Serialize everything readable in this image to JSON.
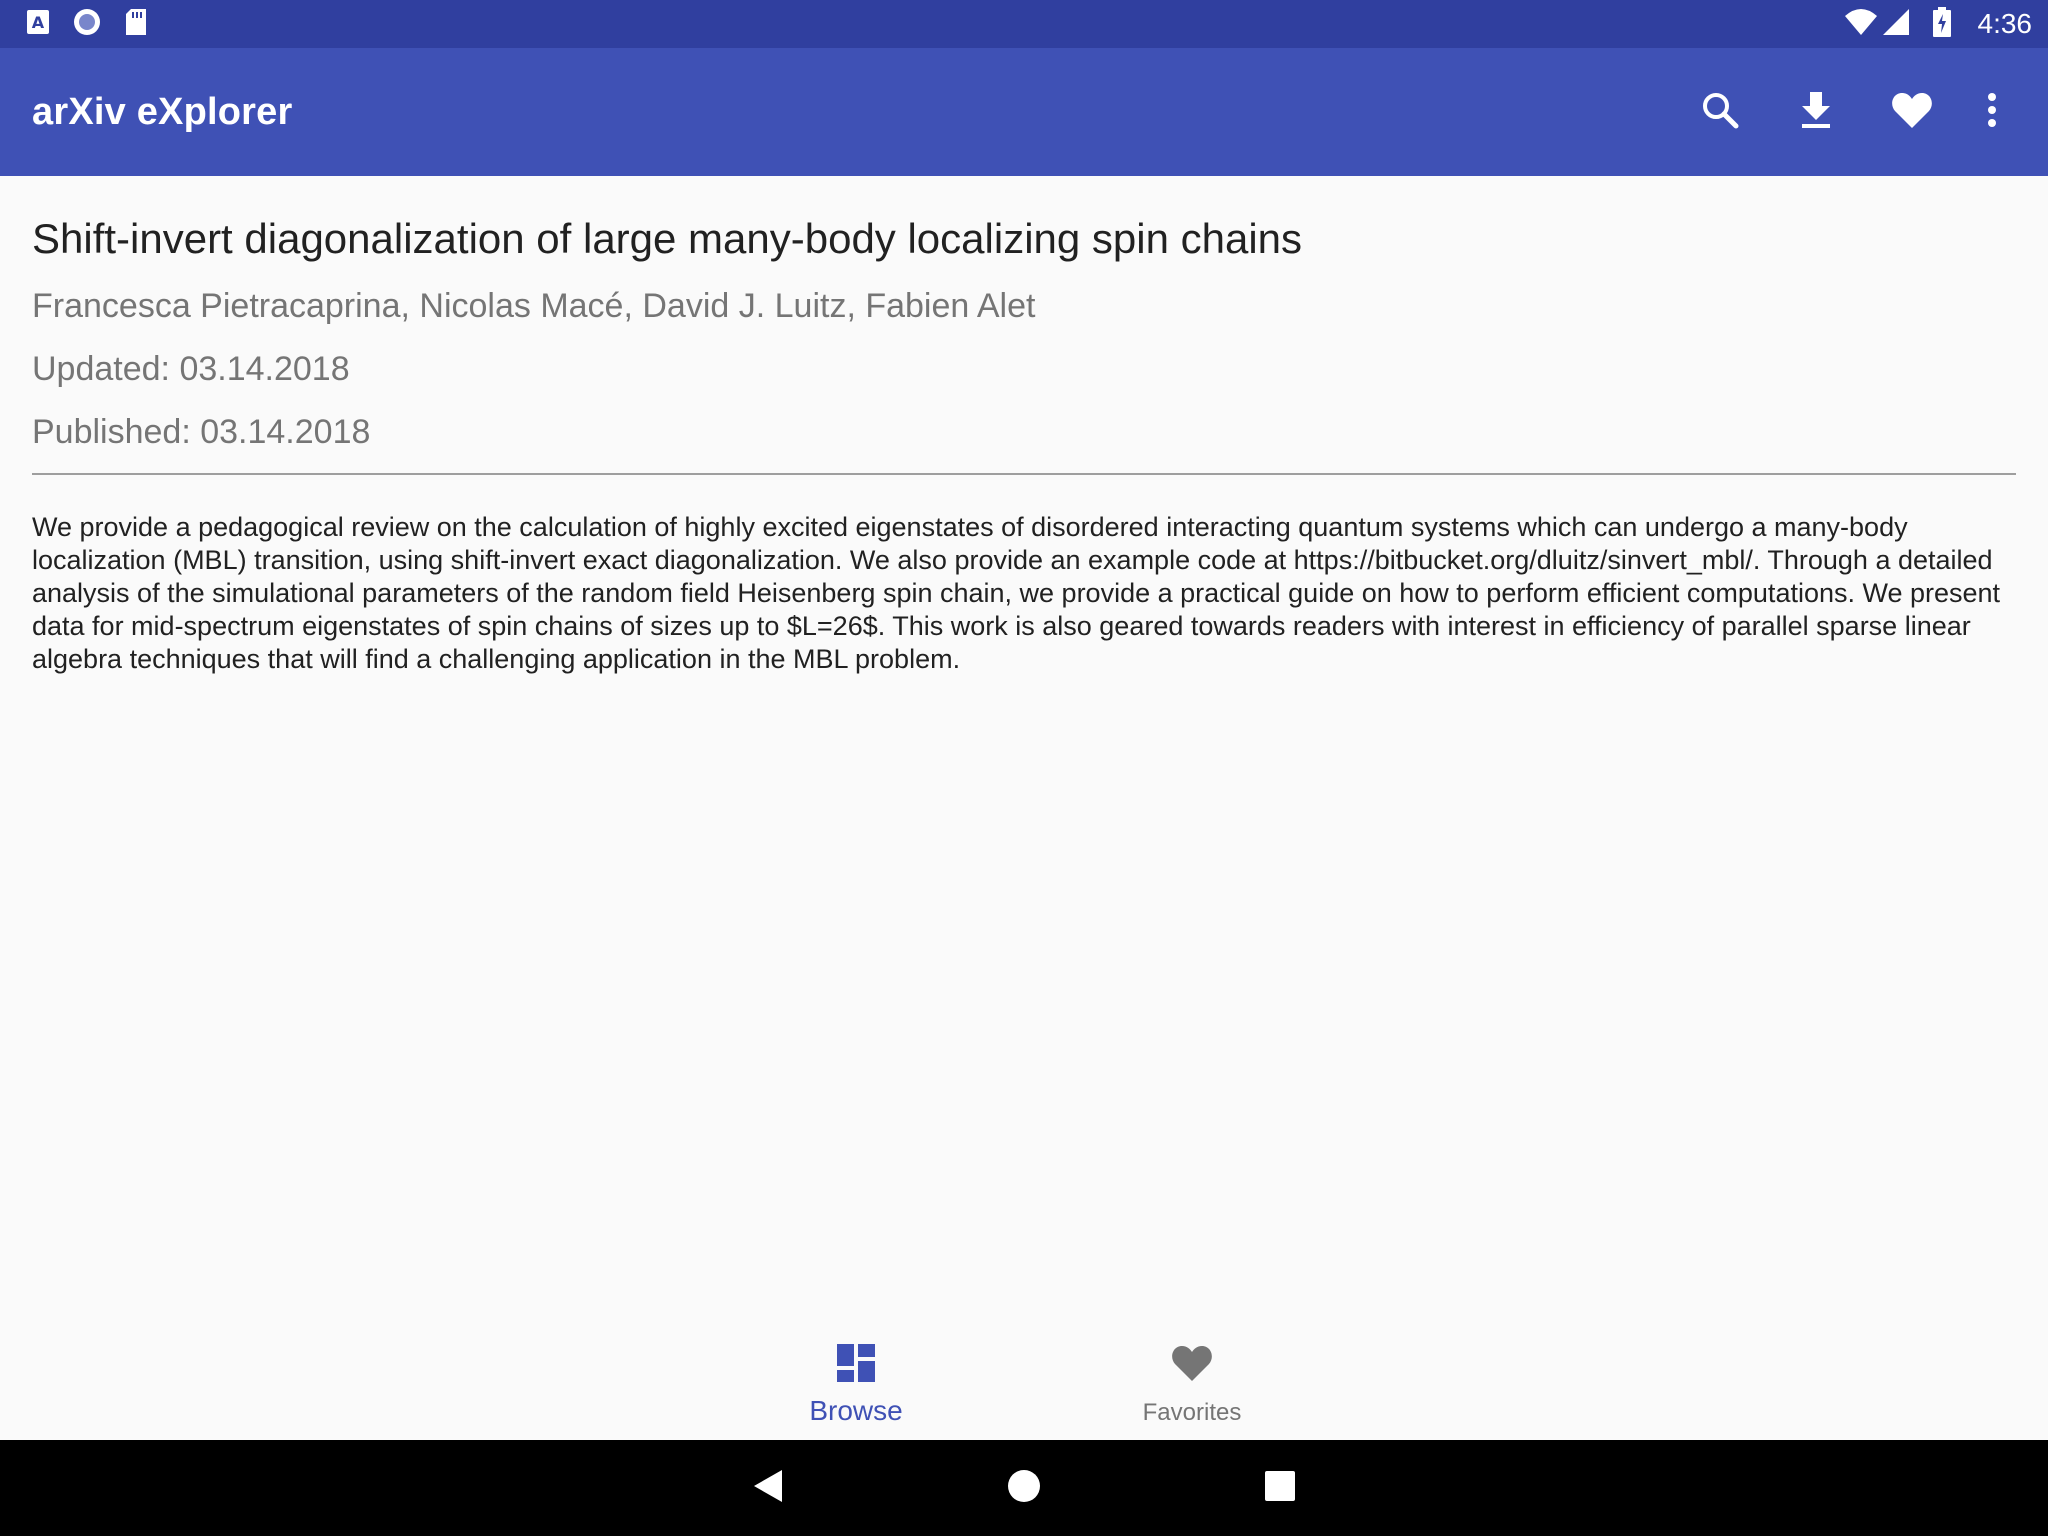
{
  "status_bar": {
    "time": "4:36",
    "left_icons": [
      "accessibility-icon",
      "record-icon",
      "sd-card-icon"
    ],
    "right_icons": [
      "wifi-icon",
      "signal-icon",
      "battery-charging-icon"
    ]
  },
  "app_bar": {
    "title": "arXiv eXplorer",
    "actions": [
      "search-icon",
      "download-icon",
      "heart-icon",
      "more-vert-icon"
    ]
  },
  "paper": {
    "title": "Shift-invert diagonalization of large many-body localizing spin chains",
    "authors": "Francesca Pietracaprina, Nicolas Macé, David J. Luitz, Fabien Alet",
    "updated": "Updated: 03.14.2018",
    "published": "Published: 03.14.2018",
    "abstract": "We provide a pedagogical review on the calculation of highly excited eigenstates of disordered interacting quantum systems which can undergo a many-body localization (MBL) transition, using shift-invert exact diagonalization. We also provide an example code at https://bitbucket.org/dluitz/sinvert_mbl/. Through a detailed analysis of the simulational parameters of the random field Heisenberg spin chain, we provide a practical guide on how to perform efficient computations. We present data for mid-spectrum eigenstates of spin chains of sizes up to $L=26$. This work is also geared towards readers with interest in efficiency of parallel sparse linear algebra techniques that will find a challenging application in the MBL problem."
  },
  "bottom_nav": {
    "items": [
      {
        "label": "Browse",
        "icon": "dashboard-icon",
        "selected": true
      },
      {
        "label": "Favorites",
        "icon": "heart-icon",
        "selected": false
      }
    ]
  },
  "colors": {
    "status_bar": "#303f9f",
    "app_bar": "#3f51b5",
    "accent": "#3f51b5",
    "background": "#fafafa"
  }
}
